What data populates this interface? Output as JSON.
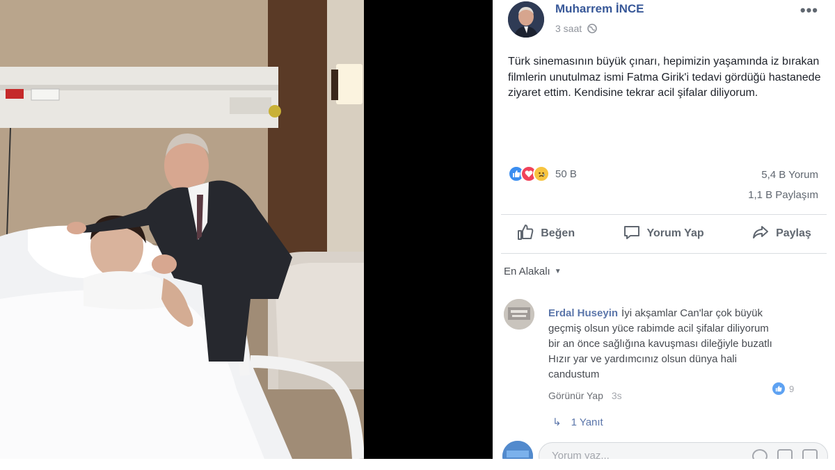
{
  "post": {
    "author": "Muharrem İNCE",
    "time": "3 saat",
    "privacy_icon": "globe-icon",
    "more_icon": "more-options-icon",
    "text": "Türk sinemasının büyük çınarı, hepimizin yaşamında iz bırakan filmlerin unutulmaz ismi Fatma Girik'i tedavi gördüğü hastanede ziyaret ettim. Kendisine tekrar acil şifalar diliyorum."
  },
  "reactions": {
    "icons": [
      "like-reaction-icon",
      "love-reaction-icon",
      "sad-reaction-icon"
    ],
    "count": "50 B",
    "comments": "5,4 B Yorum",
    "shares": "1,1 B Paylaşım"
  },
  "actions": {
    "like": "Beğen",
    "comment": "Yorum Yap",
    "share": "Paylaş"
  },
  "comments_section": {
    "sort_label": "En Alakalı",
    "comment": {
      "author": "Erdal Huseyin",
      "text": "İyi akşamlar Can'lar çok büyük geçmiş olsun yüce rabimde acil şifalar diliyorum bir an önce sağlığına kavuşması dileğiyle buzatlı Hızır yar ve yardımcınız olsun dünya hali candustum",
      "reaction_count": "9",
      "reply_link": "Görünür Yap",
      "time": "3s"
    },
    "replies_label": "1 Yanıt",
    "composer_placeholder": "Yorum yaz..."
  },
  "colors": {
    "brand_blue": "#385898",
    "like_blue": "#3b8ef0",
    "love_red": "#f0435a",
    "sad_yellow": "#f7c440",
    "text_gray": "#606770"
  }
}
